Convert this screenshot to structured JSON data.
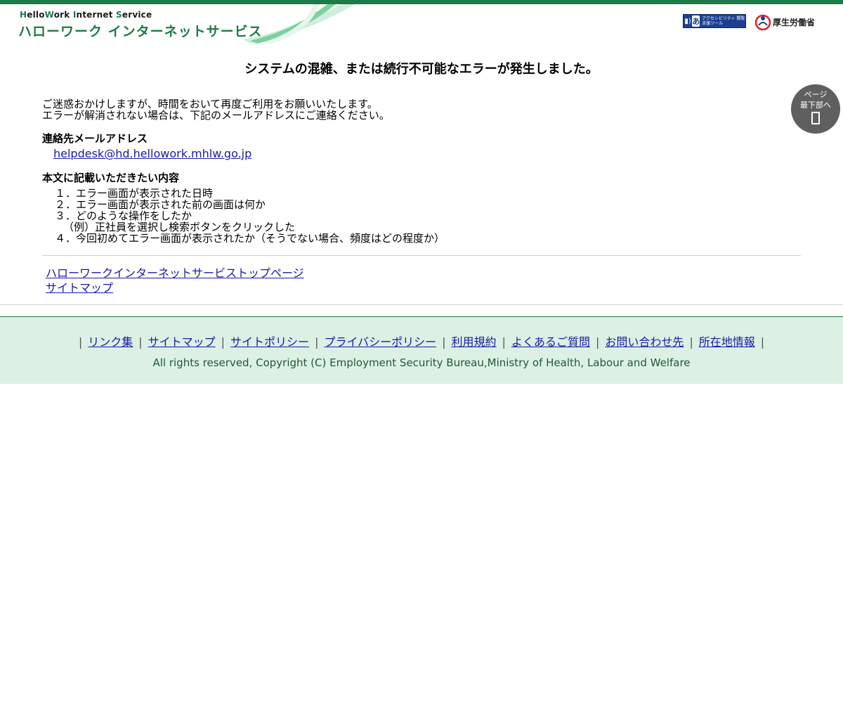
{
  "header": {
    "logo_en_parts": [
      "H",
      "ello",
      "W",
      "ork ",
      "I",
      "nternet ",
      "S",
      "ervice"
    ],
    "logo_jp": "ハローワーク インターネットサービス",
    "accessibility_tool_text": "アクセシビリティ 閲覧支援ツール",
    "ministry_name": "厚生労働省"
  },
  "main": {
    "title": "システムの混雑、または続行不可能なエラーが発生しました。",
    "intro": [
      "ご迷惑おかけしますが、時間をおいて再度ご利用をお願いいたします。",
      "エラーが解消されない場合は、下記のメールアドレスにご連絡ください。"
    ],
    "mail_heading": "連絡先メールアドレス",
    "mail_address": "helpdesk@hd.hellowork.mhlw.go.jp",
    "body_heading": "本文に記載いただきたい内容",
    "items": [
      "１．エラー画面が表示された日時",
      "２．エラー画面が表示された前の画面は何か",
      "３．どのような操作をしたか",
      "（例）正社員を選択し検索ボタンをクリックした",
      "４．今回初めてエラー画面が表示されたか（そうでない場合、頻度はどの程度か）"
    ],
    "links": [
      "ハローワークインターネットサービストップページ",
      "サイトマップ"
    ]
  },
  "scroll_button": {
    "line1": "ページ",
    "line2": "最下部へ"
  },
  "footer": {
    "separator": "|",
    "nav": [
      "リンク集",
      "サイトマップ",
      "サイトポリシー",
      "プライバシーポリシー",
      "利用規約",
      "よくあるご質問",
      "お問い合わせ先",
      "所在地情報"
    ],
    "copyright": "All rights reserved, Copyright (C) Employment Security Bureau,Ministry of Health, Labour and Welfare"
  },
  "colors": {
    "brand_green": "#1e7a46",
    "footer_bg": "#dcf1e4",
    "link": "#1a1aa6"
  }
}
